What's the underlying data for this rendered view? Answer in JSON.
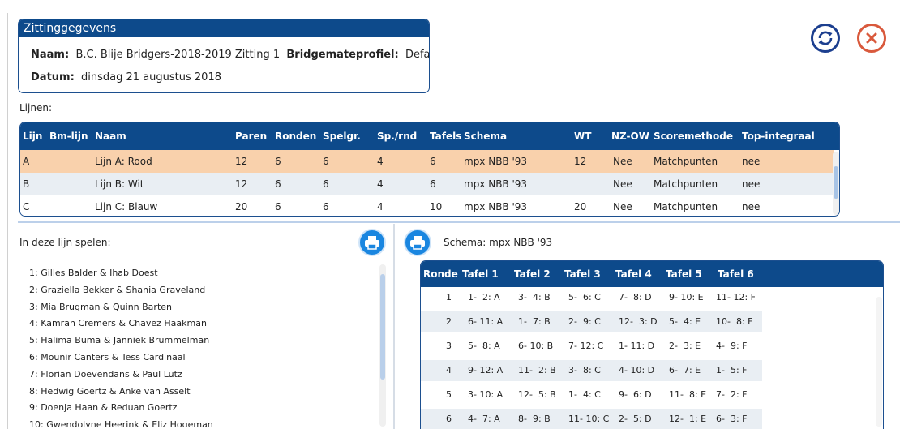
{
  "session": {
    "title": "Zittinggegevens",
    "naam_label": "Naam:",
    "naam_value": "B.C. Blije Bridgers-2018-2019  Zitting 1",
    "profile_label": "Bridgemateprofiel:",
    "profile_value": "Default",
    "datum_label": "Datum:",
    "datum_value": "dinsdag 21 augustus 2018"
  },
  "icons": {
    "refresh": "refresh-icon",
    "close": "close-icon",
    "print": "printer-icon"
  },
  "colors": {
    "header": "#0d4a8b",
    "selected_row": "#f9d1ac",
    "alt_row": "#e9eef3",
    "close": "#d9593c",
    "print": "#1a86e0"
  },
  "lines": {
    "label": "Lijnen:",
    "headers": [
      "Lijn",
      "Bm-lijn",
      "Naam",
      "Paren",
      "Ronden",
      "Spelgr.",
      "Sp./rnd",
      "Tafels",
      "Schema",
      "WT",
      "NZ-OW",
      "Scoremethode",
      "Top-integraal"
    ],
    "rows": [
      [
        "A",
        "",
        "Lijn A: Rood",
        "12",
        "6",
        "6",
        "4",
        "6",
        "mpx NBB '93",
        "12",
        "Nee",
        "Matchpunten",
        "nee"
      ],
      [
        "B",
        "",
        "Lijn B: Wit",
        "12",
        "6",
        "6",
        "4",
        "6",
        "mpx NBB '93",
        "",
        "Nee",
        "Matchpunten",
        "nee"
      ],
      [
        "C",
        "",
        "Lijn C: Blauw",
        "20",
        "6",
        "6",
        "4",
        "10",
        "mpx NBB '93",
        "20",
        "Nee",
        "Matchpunten",
        "nee"
      ]
    ]
  },
  "players": {
    "label": "In deze lijn spelen:",
    "items": [
      "1: Gilles Balder & Ihab Doest",
      "2: Graziella Bekker & Shania Graveland",
      "3: Mia Brugman & Quinn Barten",
      "4: Kamran Cremers & Chavez Haakman",
      "5: Halima Buma & Janniek Brummelman",
      "6: Mounir Canters & Tess Cardinaal",
      "7: Florian Doevendans & Paul Lutz",
      "8: Hedwig Goertz & Anke van  Asselt",
      "9: Doenja Haan & Reduan Goertz",
      "10: Gwendolyne Heerink & Eliz Hogeman"
    ]
  },
  "schema": {
    "label": "Schema: mpx NBB '93",
    "headers": [
      "Ronde",
      "Tafel 1",
      "Tafel 2",
      "Tafel 3",
      "Tafel 4",
      "Tafel 5",
      "Tafel 6"
    ],
    "rows": [
      [
        "1",
        "1-  2: A",
        "3-  4: B",
        "5-  6: C",
        "7-  8: D",
        "9- 10: E",
        "11- 12: F"
      ],
      [
        "2",
        "6- 11: A",
        "1-  7: B",
        "2-  9: C",
        "12-  3: D",
        "5-  4: E",
        "10-  8: F"
      ],
      [
        "3",
        "5-  8: A",
        "6- 10: B",
        "7- 12: C",
        "1- 11: D",
        "2-  3: E",
        "4-  9: F"
      ],
      [
        "4",
        "9- 12: A",
        "11-  2: B",
        "3-  8: C",
        "4- 10: D",
        "6-  7: E",
        "1-  5: F"
      ],
      [
        "5",
        "3- 10: A",
        "12-  5: B",
        "1-  4: C",
        "9-  6: D",
        "11-  8: E",
        "7-  2: F"
      ],
      [
        "6",
        "4-  7: A",
        "8-  9: B",
        "11- 10: C",
        "2-  5: D",
        "12-  1: E",
        "6-  3: F"
      ]
    ]
  }
}
